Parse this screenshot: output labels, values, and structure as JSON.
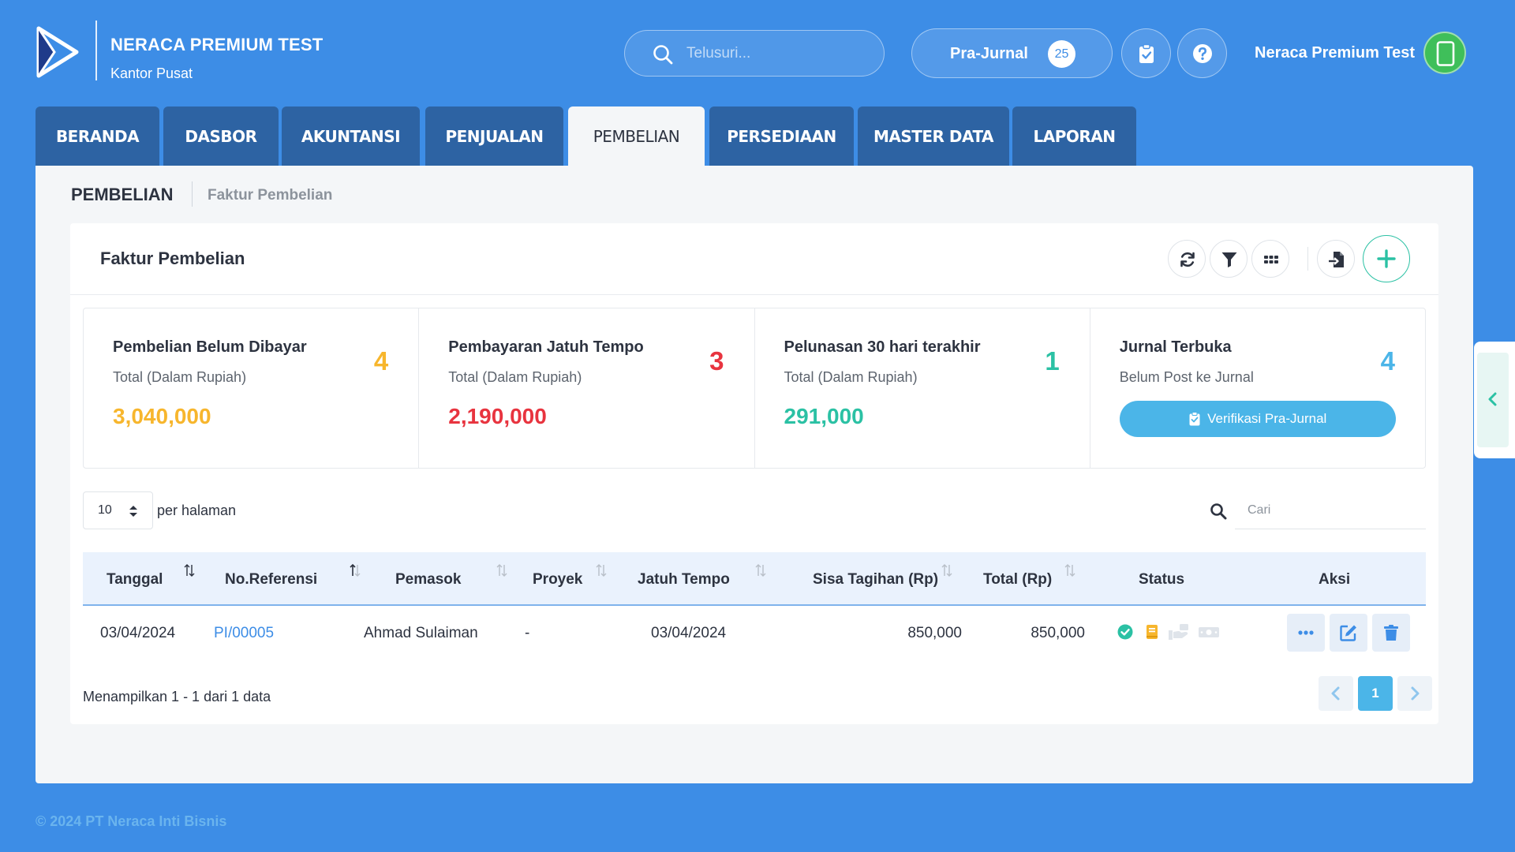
{
  "header": {
    "company_name": "NERACA PREMIUM TEST",
    "branch": "Kantor Pusat",
    "search_placeholder": "Telusuri...",
    "prajurnal_label": "Pra-Jurnal",
    "prajurnal_count": "25",
    "user_name": "Neraca Premium Test"
  },
  "nav": {
    "tabs": [
      "BERANDA",
      "DASBOR",
      "AKUNTANSI",
      "PENJUALAN",
      "PEMBELIAN",
      "PERSEDIAAN",
      "MASTER DATA",
      "LAPORAN"
    ],
    "active": "PEMBELIAN"
  },
  "breadcrumb": {
    "section": "PEMBELIAN",
    "page": "Faktur Pembelian"
  },
  "card": {
    "title": "Faktur Pembelian"
  },
  "stats": [
    {
      "title": "Pembelian Belum Dibayar",
      "subtitle": "Total (Dalam Rupiah)",
      "count": "4",
      "value": "3,040,000",
      "color": "#f7b62d"
    },
    {
      "title": "Pembayaran Jatuh Tempo",
      "subtitle": "Total (Dalam Rupiah)",
      "count": "3",
      "value": "2,190,000",
      "color": "#e8343f"
    },
    {
      "title": "Pelunasan 30 hari terakhir",
      "subtitle": "Total (Dalam Rupiah)",
      "count": "1",
      "value": "291,000",
      "color": "#2bc1a4"
    },
    {
      "title": "Jurnal Terbuka",
      "subtitle": "Belum Post ke Jurnal",
      "count": "4",
      "button": "Verifikasi Pra-Jurnal",
      "color": "#4bb5e8"
    }
  ],
  "table": {
    "per_page": "10",
    "per_page_label": "per halaman",
    "search_placeholder": "Cari",
    "columns": [
      "Tanggal",
      "No.Referensi",
      "Pemasok",
      "Proyek",
      "Jatuh Tempo",
      "Sisa Tagihan (Rp)",
      "Total (Rp)",
      "Status",
      "Aksi"
    ],
    "rows": [
      {
        "tanggal": "03/04/2024",
        "no_referensi": "PI/00005",
        "pemasok": "Ahmad Sulaiman",
        "proyek": "-",
        "jatuh_tempo": "03/04/2024",
        "sisa_tagihan": "850,000",
        "total": "850,000",
        "status_icons": [
          "check-circle-icon",
          "book-icon",
          "hand-money-icon",
          "cash-icon"
        ]
      }
    ],
    "showing": "Menampilkan 1 - 1 dari 1 data",
    "current_page": "1"
  },
  "footer": {
    "text": "© 2024 PT Neraca Inti Bisnis"
  },
  "colors": {
    "background": "#3d8de6",
    "nav_tab": "#2d63a3",
    "accent_teal": "#2bc1a4",
    "link": "#3d8de6"
  }
}
